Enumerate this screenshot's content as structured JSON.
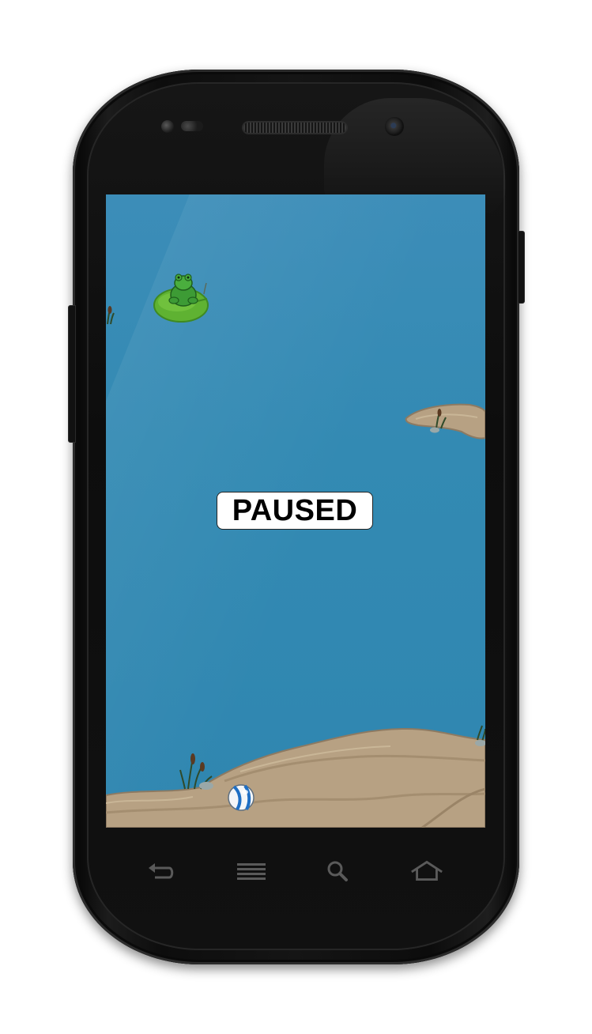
{
  "game": {
    "status_label": "PAUSED"
  },
  "device": {
    "nav_keys": [
      "back-icon",
      "menu-icon",
      "search-icon",
      "home-icon"
    ]
  },
  "colors": {
    "water": "#3089b2",
    "sand": "#b29e7f",
    "lilypad": "#6bbf3a",
    "frog": "#2f8a2a",
    "ball_stripe": "#1f6fc4"
  }
}
